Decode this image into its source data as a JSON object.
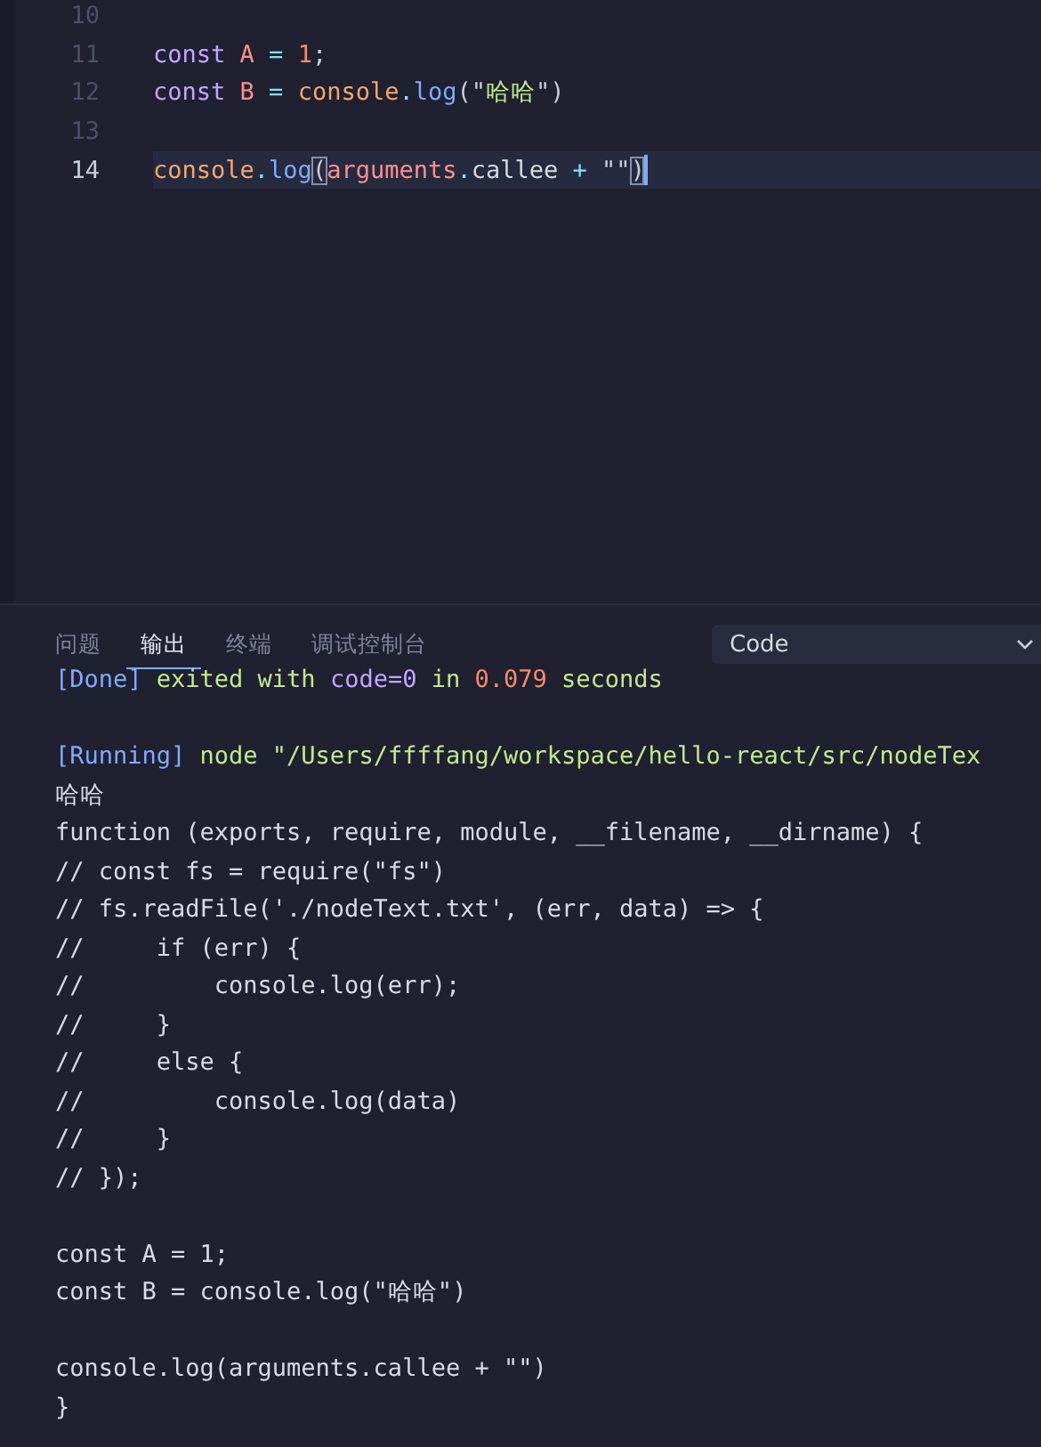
{
  "editor": {
    "lines": [
      {
        "number": "10",
        "active": false
      },
      {
        "number": "11",
        "active": false,
        "tokens": [
          {
            "text": "const ",
            "kind": "keyword"
          },
          {
            "text": "A",
            "kind": "variable"
          },
          {
            "text": " = ",
            "kind": "operator"
          },
          {
            "text": "1",
            "kind": "number"
          },
          {
            "text": ";",
            "kind": "punct"
          }
        ]
      },
      {
        "number": "12",
        "active": false,
        "tokens": [
          {
            "text": "const ",
            "kind": "keyword"
          },
          {
            "text": "B",
            "kind": "variable"
          },
          {
            "text": " = ",
            "kind": "operator"
          },
          {
            "text": "console",
            "kind": "object"
          },
          {
            "text": ".",
            "kind": "operator"
          },
          {
            "text": "log",
            "kind": "function"
          },
          {
            "text": "(\"",
            "kind": "punct"
          },
          {
            "text": "哈哈",
            "kind": "string"
          },
          {
            "text": "\")",
            "kind": "punct"
          }
        ]
      },
      {
        "number": "13",
        "active": false
      },
      {
        "number": "14",
        "active": true,
        "tokens": [
          {
            "text": "console",
            "kind": "object"
          },
          {
            "text": ".",
            "kind": "operator"
          },
          {
            "text": "log",
            "kind": "function"
          },
          {
            "text": "(",
            "kind": "bracket"
          },
          {
            "text": "arguments",
            "kind": "variable"
          },
          {
            "text": ".",
            "kind": "operator"
          },
          {
            "text": "callee",
            "kind": "plain"
          },
          {
            "text": " + ",
            "kind": "operator"
          },
          {
            "text": "\"\"",
            "kind": "punct"
          },
          {
            "text": ")",
            "kind": "bracket"
          }
        ]
      }
    ]
  },
  "panel": {
    "tabs": [
      {
        "label": "问题",
        "selected": false
      },
      {
        "label": "输出",
        "selected": true
      },
      {
        "label": "终端",
        "selected": false
      },
      {
        "label": "调试控制台",
        "selected": false
      }
    ],
    "dropdown": {
      "value": "Code"
    },
    "output": [
      {
        "kind": "text",
        "tokens": [
          {
            "text": "[Done]",
            "kind": "tag"
          },
          {
            "text": " exited with ",
            "kind": "message"
          },
          {
            "text": "code=0",
            "kind": "code"
          },
          {
            "text": " in ",
            "kind": "message"
          },
          {
            "text": "0.079",
            "kind": "number"
          },
          {
            "text": " seconds",
            "kind": "message"
          }
        ]
      },
      {
        "kind": "blank"
      },
      {
        "kind": "text",
        "tokens": [
          {
            "text": "[Running]",
            "kind": "tag"
          },
          {
            "text": " node \"/Users/ffffang/workspace/hello-react/src/nodeTex",
            "kind": "message"
          }
        ]
      },
      {
        "kind": "text",
        "tokens": [
          {
            "text": "哈哈",
            "kind": "plain"
          }
        ]
      },
      {
        "kind": "text",
        "tokens": [
          {
            "text": "function (exports, require, module, __filename, __dirname) {",
            "kind": "plain"
          }
        ]
      },
      {
        "kind": "text",
        "tokens": [
          {
            "text": "// const fs = require(\"fs\")",
            "kind": "plain"
          }
        ]
      },
      {
        "kind": "text",
        "tokens": [
          {
            "text": "// fs.readFile('./nodeText.txt', (err, data) => {",
            "kind": "plain"
          }
        ]
      },
      {
        "kind": "text",
        "tokens": [
          {
            "text": "//     if (err) {",
            "kind": "plain"
          }
        ]
      },
      {
        "kind": "text",
        "tokens": [
          {
            "text": "//         console.log(err);",
            "kind": "plain"
          }
        ]
      },
      {
        "kind": "text",
        "tokens": [
          {
            "text": "//     }",
            "kind": "plain"
          }
        ]
      },
      {
        "kind": "text",
        "tokens": [
          {
            "text": "//     else {",
            "kind": "plain"
          }
        ]
      },
      {
        "kind": "text",
        "tokens": [
          {
            "text": "//         console.log(data)",
            "kind": "plain"
          }
        ]
      },
      {
        "kind": "text",
        "tokens": [
          {
            "text": "//     }",
            "kind": "plain"
          }
        ]
      },
      {
        "kind": "text",
        "tokens": [
          {
            "text": "// });",
            "kind": "plain"
          }
        ]
      },
      {
        "kind": "blank"
      },
      {
        "kind": "text",
        "tokens": [
          {
            "text": "const A = 1;",
            "kind": "plain"
          }
        ]
      },
      {
        "kind": "text",
        "tokens": [
          {
            "text": "const B = console.log(\"哈哈\")",
            "kind": "plain"
          }
        ]
      },
      {
        "kind": "blank"
      },
      {
        "kind": "text",
        "tokens": [
          {
            "text": "console.log(arguments.callee + \"\")",
            "kind": "plain"
          }
        ]
      },
      {
        "kind": "text",
        "tokens": [
          {
            "text": "}",
            "kind": "plain"
          }
        ]
      }
    ]
  }
}
